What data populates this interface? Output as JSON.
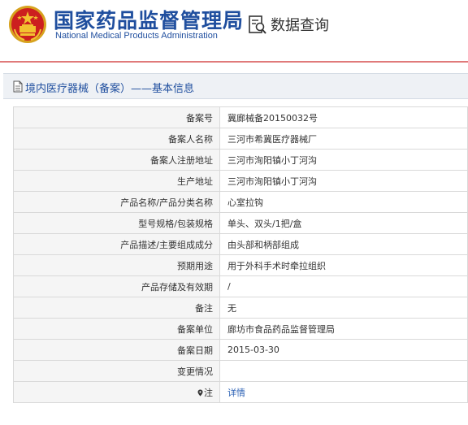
{
  "header": {
    "brand_cn": "国家药品监督管理局",
    "brand_en": "National Medical Products Administration",
    "query_label": "数据查询",
    "accent_color": "#1f4e9e",
    "line_color": "#e07a7a"
  },
  "section": {
    "title": "境内医疗器械（备案）——基本信息"
  },
  "rows": [
    {
      "label": "备案号",
      "value": "冀廊械备20150032号"
    },
    {
      "label": "备案人名称",
      "value": "三河市希冀医疗器械厂"
    },
    {
      "label": "备案人注册地址",
      "value": "三河市洵阳镇小丁河沟"
    },
    {
      "label": "生产地址",
      "value": "三河市洵阳镇小丁河沟"
    },
    {
      "label": "产品名称/产品分类名称",
      "value": "心室拉钩"
    },
    {
      "label": "型号规格/包装规格",
      "value": "单头、双头/1把/盒"
    },
    {
      "label": "产品描述/主要组成成分",
      "value": "由头部和柄部组成"
    },
    {
      "label": "预期用途",
      "value": "用于外科手术时牵拉组织"
    },
    {
      "label": "产品存储及有效期",
      "value": "/"
    },
    {
      "label": "备注",
      "value": "无"
    },
    {
      "label": "备案单位",
      "value": "廊坊市食品药品监督管理局"
    },
    {
      "label": "备案日期",
      "value": "2015-03-30"
    },
    {
      "label": "变更情况",
      "value": ""
    }
  ],
  "note": {
    "label": "注",
    "link_text": "详情"
  }
}
